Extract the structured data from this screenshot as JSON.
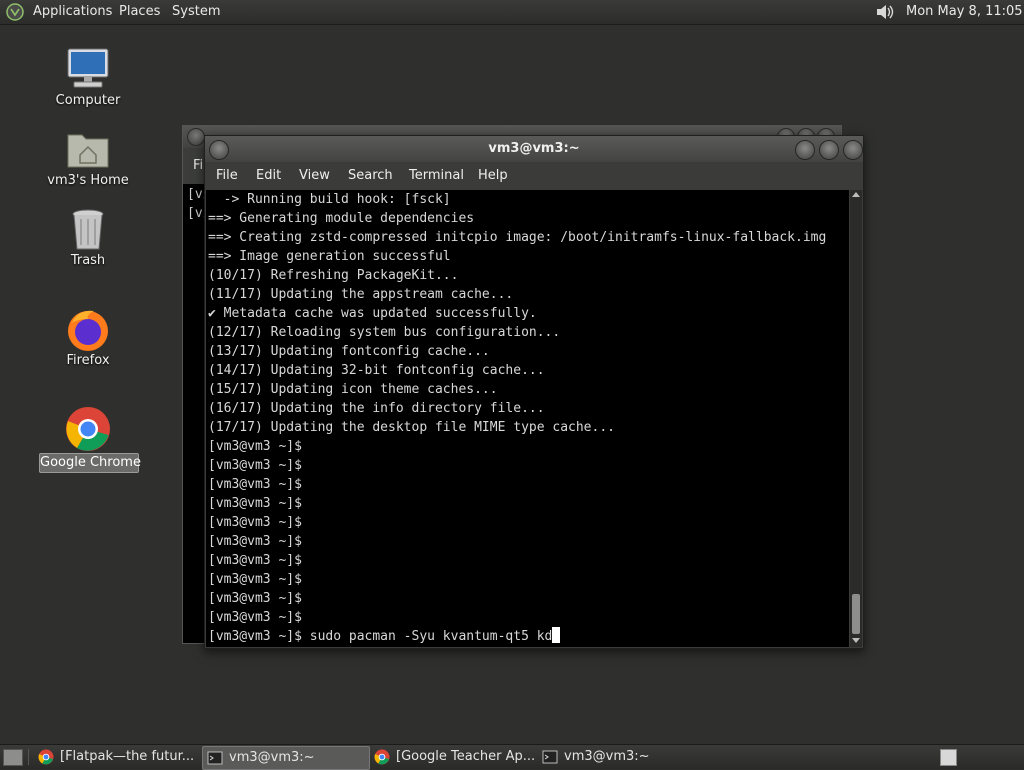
{
  "top_panel": {
    "menus": [
      "Applications",
      "Places",
      "System"
    ],
    "clock": "Mon May  8, 11:05",
    "icons": {
      "apps": "distro-logo-icon",
      "volume": "speaker-icon"
    }
  },
  "desktop": {
    "icons": [
      {
        "label": "Computer",
        "icon": "computer-icon"
      },
      {
        "label": "vm3's Home",
        "icon": "home-folder-icon"
      },
      {
        "label": "Trash",
        "icon": "trash-icon"
      },
      {
        "label": "Firefox",
        "icon": "firefox-icon"
      },
      {
        "label": "Google Chrome",
        "icon": "chrome-icon",
        "selected": true
      }
    ]
  },
  "background_window": {
    "menu_label": "Fi",
    "lines": [
      "[vi",
      "[vi"
    ]
  },
  "terminal": {
    "title": "vm3@vm3:~",
    "menu": [
      "File",
      "Edit",
      "View",
      "Search",
      "Terminal",
      "Help"
    ],
    "lines": [
      "  -> Running build hook: [fsck]",
      "==> Generating module dependencies",
      "==> Creating zstd-compressed initcpio image: /boot/initramfs-linux-fallback.img",
      "==> Image generation successful",
      "(10/17) Refreshing PackageKit...",
      "(11/17) Updating the appstream cache...",
      "✔ Metadata cache was updated successfully.",
      "(12/17) Reloading system bus configuration...",
      "(13/17) Updating fontconfig cache...",
      "(14/17) Updating 32-bit fontconfig cache...",
      "(15/17) Updating icon theme caches...",
      "(16/17) Updating the info directory file...",
      "(17/17) Updating the desktop file MIME type cache...",
      "[vm3@vm3 ~]$",
      "[vm3@vm3 ~]$",
      "[vm3@vm3 ~]$",
      "[vm3@vm3 ~]$",
      "[vm3@vm3 ~]$",
      "[vm3@vm3 ~]$",
      "[vm3@vm3 ~]$",
      "[vm3@vm3 ~]$",
      "[vm3@vm3 ~]$",
      "[vm3@vm3 ~]$"
    ],
    "prompt_line": "[vm3@vm3 ~]$ sudo pacman -Syu kvantum-qt5 kd"
  },
  "taskbar": {
    "tasks": [
      {
        "label": "[Flatpak—the futur...",
        "icon": "chrome-icon",
        "active": false
      },
      {
        "label": "vm3@vm3:~",
        "icon": "terminal-icon",
        "active": true
      },
      {
        "label": "[Google Teacher Ap...",
        "icon": "chrome-icon",
        "active": false
      },
      {
        "label": "vm3@vm3:~",
        "icon": "terminal-icon",
        "active": false
      }
    ]
  }
}
